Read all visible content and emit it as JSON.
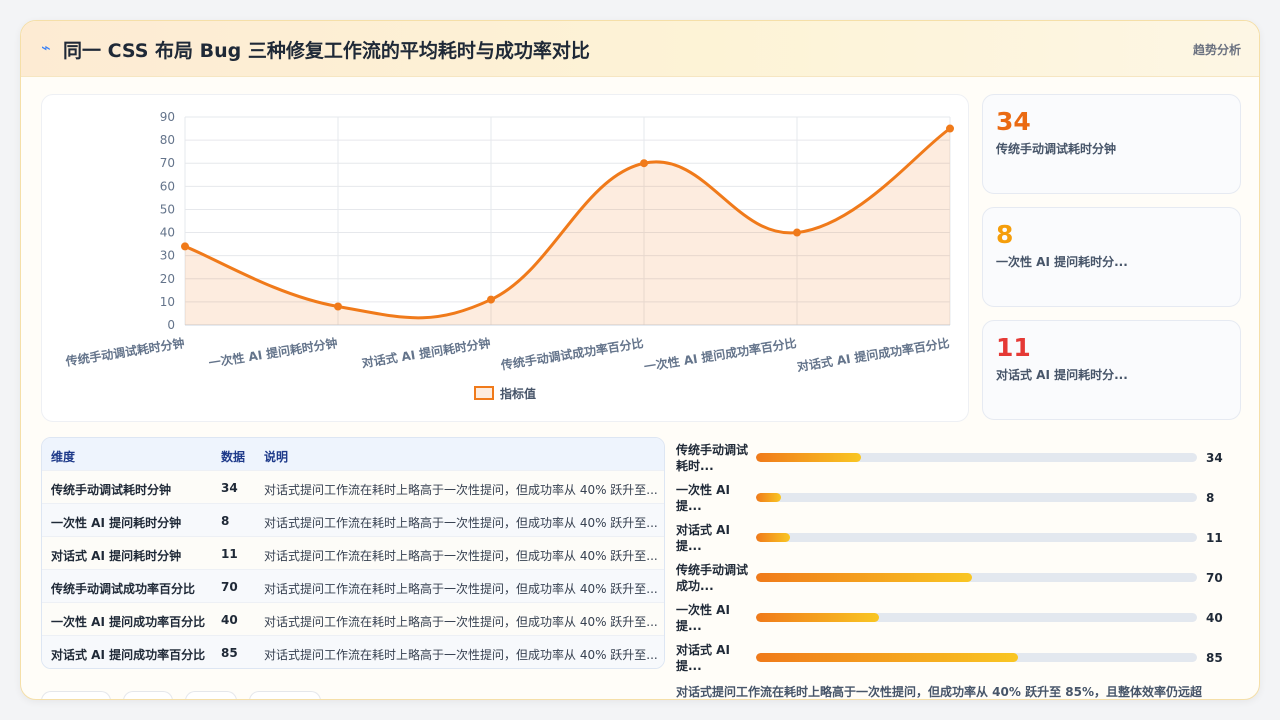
{
  "header": {
    "icon": "trend-icon",
    "title": "同一 CSS 布局 Bug 三种修复工作流的平均耗时与成功率对比",
    "link": "趋势分析"
  },
  "chart_data": {
    "type": "line",
    "categories": [
      "传统手动调试耗时分钟",
      "一次性 AI 提问耗时分钟",
      "对话式 AI 提问耗时分钟",
      "传统手动调试成功率百分比",
      "一次性 AI 提问成功率百分比",
      "对话式 AI 提问成功率百分比"
    ],
    "series": [
      {
        "name": "指标值",
        "values": [
          34,
          8,
          11,
          70,
          40,
          85
        ]
      }
    ],
    "ylim": [
      0,
      90
    ],
    "yticks": [
      0,
      10,
      20,
      30,
      40,
      50,
      60,
      70,
      80,
      90
    ],
    "grid": true,
    "legend": "bottom",
    "color": "#f07a1a"
  },
  "kpis": [
    {
      "value": "34",
      "label": "传统手动调试耗时分钟",
      "color": "#ea6a12"
    },
    {
      "value": "8",
      "label": "一次性 AI 提问耗时分...",
      "color": "#f59e0b"
    },
    {
      "value": "11",
      "label": "对话式 AI 提问耗时分...",
      "color": "#e53935"
    }
  ],
  "table": {
    "headers": [
      "维度",
      "数据",
      "说明"
    ],
    "rows": [
      [
        "传统手动调试耗时分钟",
        "34",
        "对话式提问工作流在耗时上略高于一次性提问，但成功率从 40% 跃升至..."
      ],
      [
        "一次性 AI 提问耗时分钟",
        "8",
        "对话式提问工作流在耗时上略高于一次性提问，但成功率从 40% 跃升至..."
      ],
      [
        "对话式 AI 提问耗时分钟",
        "11",
        "对话式提问工作流在耗时上略高于一次性提问，但成功率从 40% 跃升至..."
      ],
      [
        "传统手动调试成功率百分比",
        "70",
        "对话式提问工作流在耗时上略高于一次性提问，但成功率从 40% 跃升至..."
      ],
      [
        "一次性 AI 提问成功率百分比",
        "40",
        "对话式提问工作流在耗时上略高于一次性提问，但成功率从 40% 跃升至..."
      ],
      [
        "对话式 AI 提问成功率百分比",
        "85",
        "对话式提问工作流在耗时上略高于一次性提问，但成功率从 40% 跃升至..."
      ]
    ]
  },
  "bars": [
    {
      "label": "传统手动调试耗时...",
      "value": 34
    },
    {
      "label": "一次性 AI 提...",
      "value": 8
    },
    {
      "label": "对话式 AI 提...",
      "value": 11
    },
    {
      "label": "传统手动调试成功...",
      "value": 70
    },
    {
      "label": "一次性 AI 提...",
      "value": 40
    },
    {
      "label": "对话式 AI 提...",
      "value": 85
    }
  ],
  "bar_max": 143,
  "summary": "对话式提问工作流在耗时上略高于一次性提问，但成功率从 40% 跃升至 85%，且整体效率仍远超"
}
